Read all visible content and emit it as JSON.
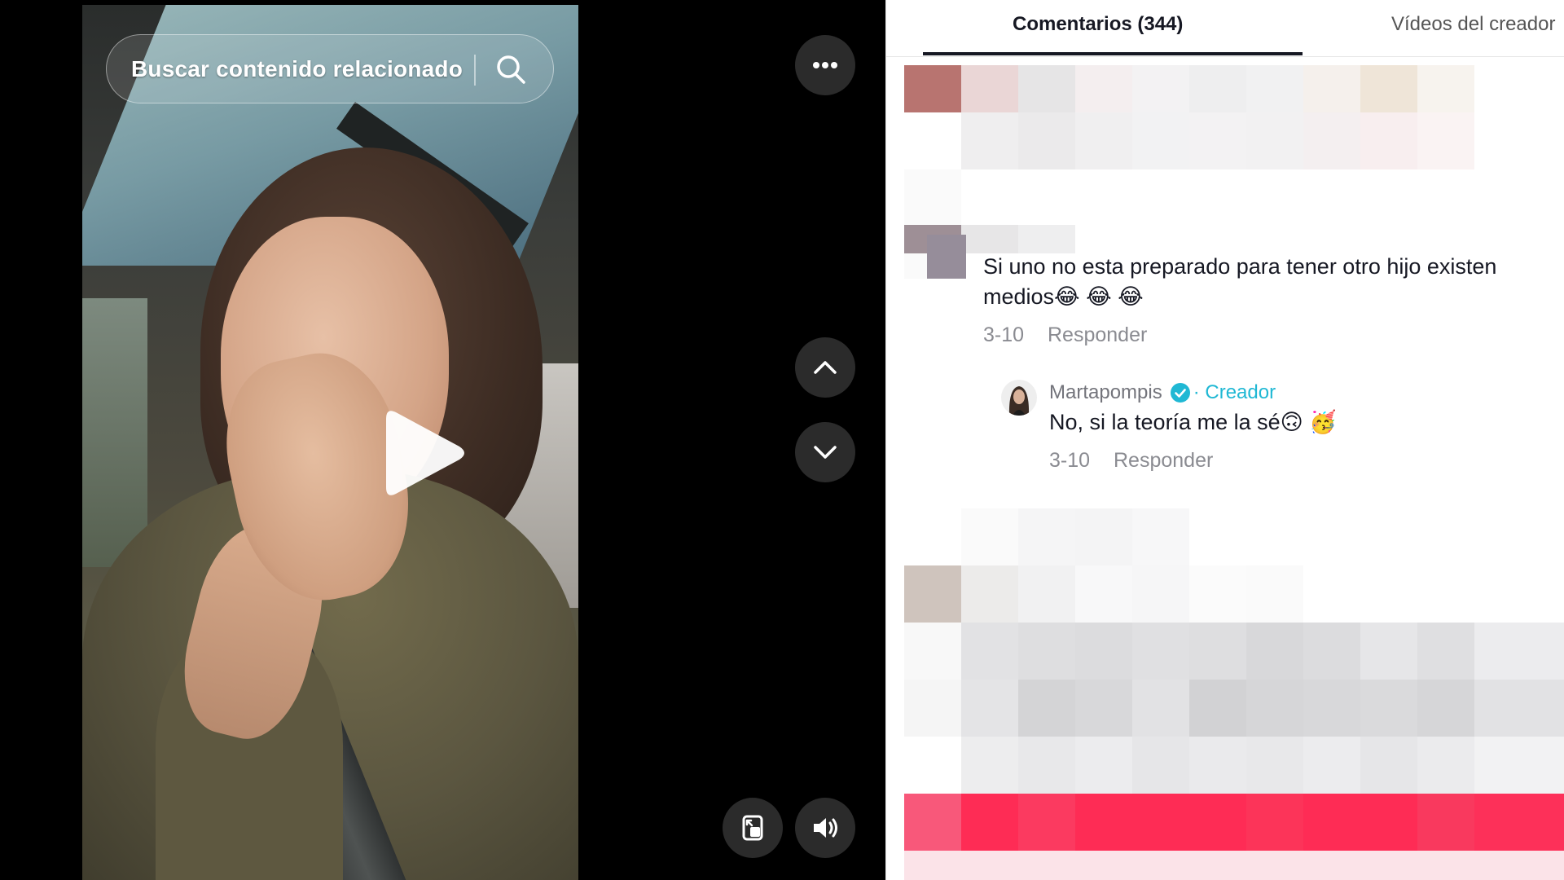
{
  "video": {
    "search_placeholder": "Buscar contenido relacionado"
  },
  "icons": {
    "search": "search-icon",
    "more": "more-horizontal-icon",
    "play": "play-icon",
    "prev": "chevron-up-icon",
    "next": "chevron-down-icon",
    "floating": "floating-player-icon",
    "volume": "volume-icon"
  },
  "panel": {
    "tabs": [
      {
        "label": "Comentarios (344)",
        "active": true
      },
      {
        "label": "Vídeos del creador",
        "active": false
      }
    ],
    "comments": [
      {
        "text": "Si uno no esta preparado para tener otro hijo existen medios😂 😂 😂",
        "date": "3-10",
        "reply_label": "Responder",
        "replies": [
          {
            "username": "Martapompis",
            "badge": "· Creador",
            "text": "No, si la teoría me la sé🙃 🥳",
            "date": "3-10",
            "reply_label": "Responder"
          }
        ]
      }
    ]
  },
  "colors": {
    "accent_badge": "#20b8d4",
    "tiktok_red": "#fe2c55",
    "button_bg": "#2b2b2b"
  }
}
